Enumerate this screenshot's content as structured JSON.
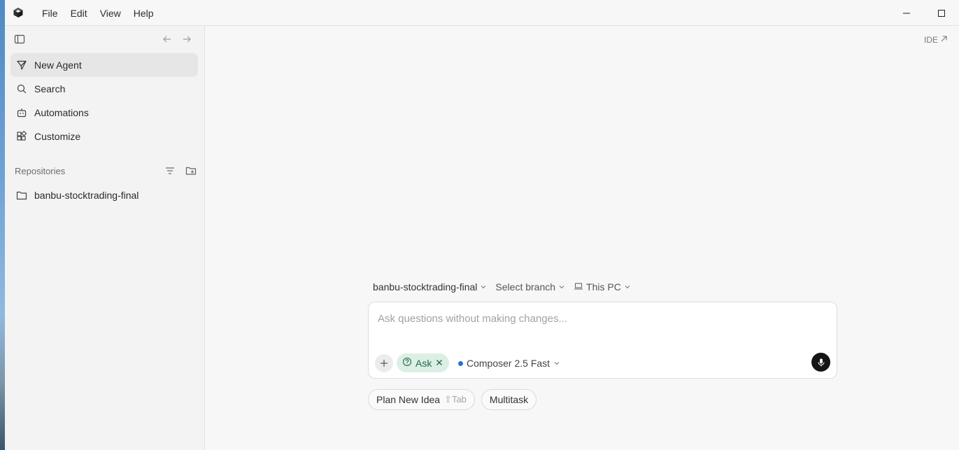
{
  "menu": [
    "File",
    "Edit",
    "View",
    "Help"
  ],
  "sidebar": {
    "nav": [
      {
        "label": "New Agent",
        "icon": "new-agent-icon",
        "active": true
      },
      {
        "label": "Search",
        "icon": "search-icon",
        "active": false
      },
      {
        "label": "Automations",
        "icon": "robot-icon",
        "active": false
      },
      {
        "label": "Customize",
        "icon": "blocks-icon",
        "active": false
      }
    ],
    "repos_title": "Repositories",
    "repos": [
      {
        "label": "banbu-stocktrading-final",
        "icon": "folder-icon"
      }
    ]
  },
  "main": {
    "ide_label": "IDE",
    "context": {
      "repo": "banbu-stocktrading-final",
      "branch": "Select branch",
      "machine": "This PC"
    },
    "composer": {
      "placeholder": "Ask questions without making changes...",
      "value": "",
      "mode": "Ask",
      "model": "Composer 2.5 Fast"
    },
    "suggestions": [
      {
        "label": "Plan New Idea",
        "shortcut": "⇧Tab"
      },
      {
        "label": "Multitask",
        "shortcut": ""
      }
    ]
  },
  "colors": {
    "accent_green_bg": "#dcefe5",
    "accent_green_text": "#1d6b48",
    "model_dot": "#2c6fcf",
    "mic_bg": "#141414"
  }
}
